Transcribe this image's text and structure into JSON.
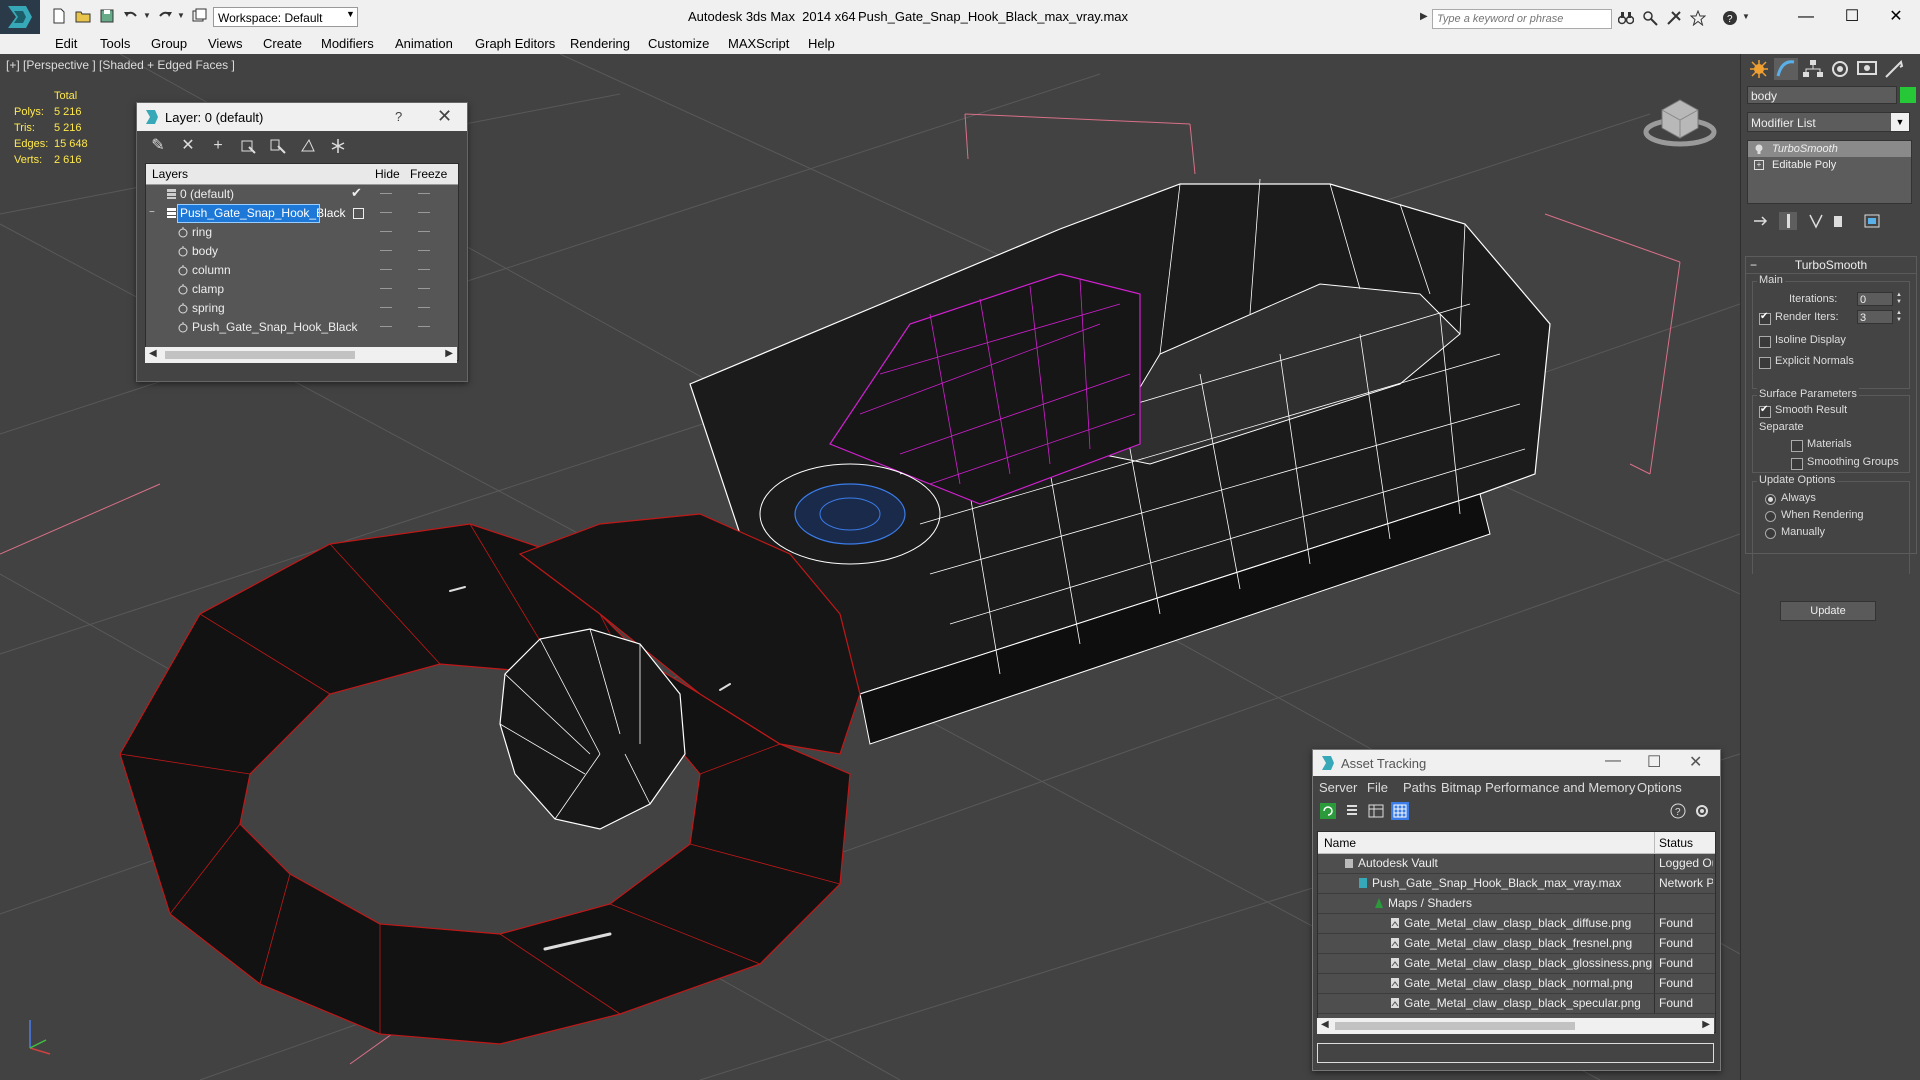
{
  "titlebar": {
    "workspace": "Workspace: Default",
    "app_title": "Autodesk 3ds Max  2014 x64",
    "file_title": "Push_Gate_Snap_Hook_Black_max_vray.max",
    "search_placeholder": "Type a keyword or phrase"
  },
  "menu": [
    "Edit",
    "Tools",
    "Group",
    "Views",
    "Create",
    "Modifiers",
    "Animation",
    "Graph Editors",
    "Rendering",
    "Customize",
    "MAXScript",
    "Help"
  ],
  "viewport": {
    "label": "[+] [Perspective ] [Shaded + Edged Faces ]",
    "stats_header": "Total",
    "stats": [
      {
        "k": "Polys:",
        "v": "5 216"
      },
      {
        "k": "Tris:",
        "v": "5 216"
      },
      {
        "k": "Edges:",
        "v": "15 648"
      },
      {
        "k": "Verts:",
        "v": "2 616"
      }
    ],
    "colors": {
      "background": "#424242",
      "ring_edges": "#c01818",
      "body_edges": "#ffffff",
      "selected_edges": "#d020d0",
      "grid": "#5a5a5a"
    }
  },
  "layer_dialog": {
    "title": "Layer: 0 (default)",
    "help": "?",
    "columns": {
      "layers": "Layers",
      "hide": "Hide",
      "freeze": "Freeze"
    },
    "rows": [
      {
        "name": "0 (default)",
        "level": 0,
        "state": "check"
      },
      {
        "name": "Push_Gate_Snap_Hook_Black",
        "level": 0,
        "selected": true,
        "state": "box"
      },
      {
        "name": "ring",
        "level": 1
      },
      {
        "name": "body",
        "level": 1
      },
      {
        "name": "column",
        "level": 1
      },
      {
        "name": "clamp",
        "level": 1
      },
      {
        "name": "spring",
        "level": 1
      },
      {
        "name": "Push_Gate_Snap_Hook_Black",
        "level": 1
      }
    ]
  },
  "command_panel": {
    "object_name": "body",
    "object_color": "#26c838",
    "modifier_list": "Modifier List",
    "stack": [
      {
        "label": "TurboSmooth",
        "selected": true
      },
      {
        "label": "Editable Poly",
        "selected": false
      }
    ],
    "rollout_title": "TurboSmooth",
    "main_label": "Main",
    "iterations_label": "Iterations:",
    "iterations_value": "0",
    "render_iters_label": "Render Iters:",
    "render_iters_value": "3",
    "isoline_label": "Isoline Display",
    "explicit_normals_label": "Explicit Normals",
    "surface_params_label": "Surface Parameters",
    "smooth_result_label": "Smooth Result",
    "separate_label": "Separate",
    "materials_label": "Materials",
    "smoothing_groups_label": "Smoothing Groups",
    "update_options_label": "Update Options",
    "radio_always": "Always",
    "radio_when_rendering": "When Rendering",
    "radio_manually": "Manually",
    "update_button": "Update"
  },
  "asset_tracking": {
    "title": "Asset Tracking",
    "menu": [
      "Server",
      "File",
      "Paths",
      "Bitmap Performance and Memory",
      "Options"
    ],
    "columns": {
      "name": "Name",
      "status": "Status"
    },
    "rows": [
      {
        "name": "Autodesk Vault",
        "status": "Logged Ou",
        "level": 1
      },
      {
        "name": "Push_Gate_Snap_Hook_Black_max_vray.max",
        "status": "Network P",
        "level": 2
      },
      {
        "name": "Maps / Shaders",
        "status": "",
        "level": 3
      },
      {
        "name": "Gate_Metal_claw_clasp_black_diffuse.png",
        "status": "Found",
        "level": 4
      },
      {
        "name": "Gate_Metal_claw_clasp_black_fresnel.png",
        "status": "Found",
        "level": 4
      },
      {
        "name": "Gate_Metal_claw_clasp_black_glossiness.png",
        "status": "Found",
        "level": 4
      },
      {
        "name": "Gate_Metal_claw_clasp_black_normal.png",
        "status": "Found",
        "level": 4
      },
      {
        "name": "Gate_Metal_claw_clasp_black_specular.png",
        "status": "Found",
        "level": 4
      }
    ]
  }
}
